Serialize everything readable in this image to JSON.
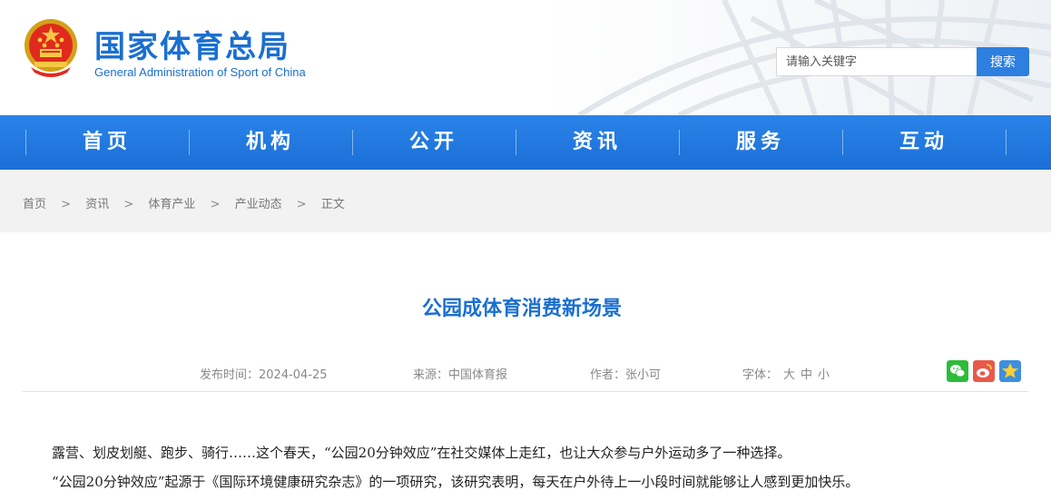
{
  "header": {
    "title": "国家体育总局",
    "subtitle": "General Administration of Sport of China",
    "search_placeholder": "请输入关键字",
    "search_button": "搜索",
    "accent": "#1a6fd0"
  },
  "nav": {
    "items": [
      {
        "label": "首页"
      },
      {
        "label": "机构"
      },
      {
        "label": "公开"
      },
      {
        "label": "资讯"
      },
      {
        "label": "服务"
      },
      {
        "label": "互动"
      }
    ]
  },
  "breadcrumb": {
    "items": [
      "首页",
      "资讯",
      "体育产业",
      "产业动态",
      "正文"
    ],
    "separator": ">"
  },
  "article": {
    "title": "公园成体育消费新场景",
    "publish_label": "发布时间：",
    "publish_date": "2024-04-25",
    "source_label": "来源：",
    "source": "中国体育报",
    "author_label": "作者：",
    "author": "张小可",
    "font_label": "字体：",
    "font_large": "大",
    "font_medium": "中",
    "font_small": "小",
    "share_icons": [
      "wechat-icon",
      "weibo-icon",
      "qzone-icon"
    ],
    "paragraphs": [
      "露营、划皮划艇、跑步、骑行……这个春天，“公园20分钟效应”在社交媒体上走红，也让大众参与户外运动多了一种选择。",
      "“公园20分钟效应”起源于《国际环境健康研究杂志》的一项研究，该研究表明，每天在户外待上一小段时间就能够让人感到更加快乐。"
    ]
  }
}
